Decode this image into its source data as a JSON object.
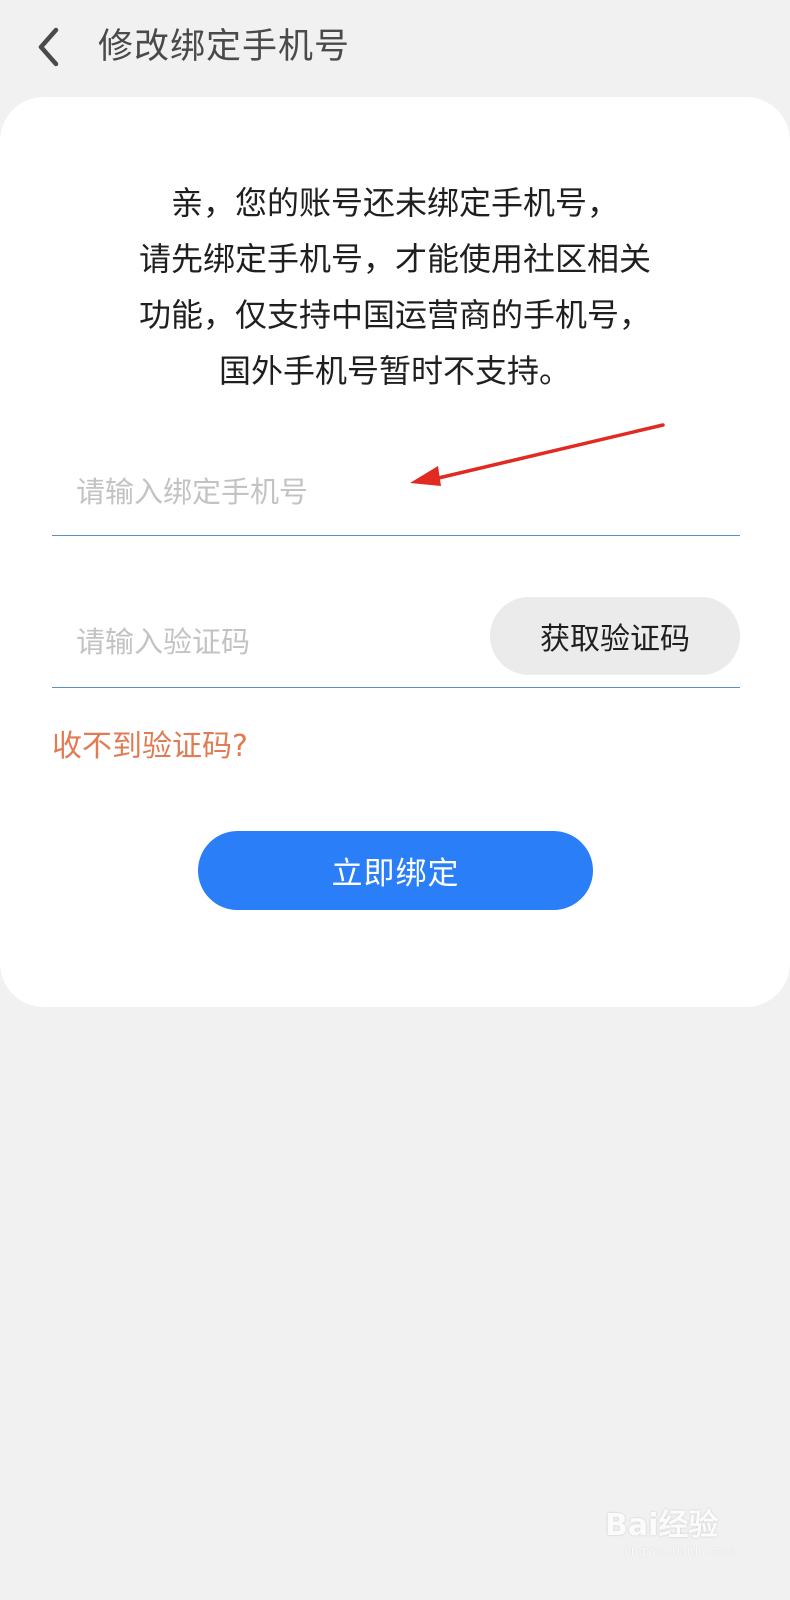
{
  "header": {
    "back_icon": "chevron-left-icon",
    "title": "修改绑定手机号"
  },
  "notice": {
    "lines": [
      "亲，您的账号还未绑定手机号，",
      "请先绑定手机号，才能使用社区相关",
      "功能，仅支持中国运营商的手机号，",
      "国外手机号暂时不支持。"
    ]
  },
  "form": {
    "phone": {
      "value": "",
      "placeholder": "请输入绑定手机号"
    },
    "code": {
      "value": "",
      "placeholder": "请输入验证码"
    },
    "get_code_label": "获取验证码",
    "no_code_link": "收不到验证码?",
    "submit_label": "立即绑定"
  },
  "annotation": {
    "type": "red-arrow",
    "color": "#e02a22"
  },
  "watermark": {
    "logo_text": "Bai经验",
    "url": "jingyan.baidu.com"
  },
  "colors": {
    "background": "#f1f1f1",
    "card": "#ffffff",
    "primary": "#2a7ef7",
    "link": "#e27b54",
    "underline": "#5d8fc7",
    "placeholder": "#c3c3c3",
    "secondary_button": "#ebebeb"
  }
}
